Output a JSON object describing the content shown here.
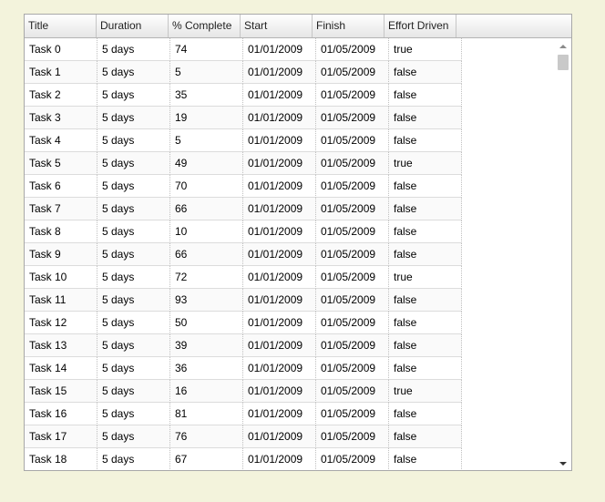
{
  "columns": [
    "Title",
    "Duration",
    "% Complete",
    "Start",
    "Finish",
    "Effort Driven"
  ],
  "rows": [
    [
      "Task 0",
      "5 days",
      "74",
      "01/01/2009",
      "01/05/2009",
      "true"
    ],
    [
      "Task 1",
      "5 days",
      "5",
      "01/01/2009",
      "01/05/2009",
      "false"
    ],
    [
      "Task 2",
      "5 days",
      "35",
      "01/01/2009",
      "01/05/2009",
      "false"
    ],
    [
      "Task 3",
      "5 days",
      "19",
      "01/01/2009",
      "01/05/2009",
      "false"
    ],
    [
      "Task 4",
      "5 days",
      "5",
      "01/01/2009",
      "01/05/2009",
      "false"
    ],
    [
      "Task 5",
      "5 days",
      "49",
      "01/01/2009",
      "01/05/2009",
      "true"
    ],
    [
      "Task 6",
      "5 days",
      "70",
      "01/01/2009",
      "01/05/2009",
      "false"
    ],
    [
      "Task 7",
      "5 days",
      "66",
      "01/01/2009",
      "01/05/2009",
      "false"
    ],
    [
      "Task 8",
      "5 days",
      "10",
      "01/01/2009",
      "01/05/2009",
      "false"
    ],
    [
      "Task 9",
      "5 days",
      "66",
      "01/01/2009",
      "01/05/2009",
      "false"
    ],
    [
      "Task 10",
      "5 days",
      "72",
      "01/01/2009",
      "01/05/2009",
      "true"
    ],
    [
      "Task 11",
      "5 days",
      "93",
      "01/01/2009",
      "01/05/2009",
      "false"
    ],
    [
      "Task 12",
      "5 days",
      "50",
      "01/01/2009",
      "01/05/2009",
      "false"
    ],
    [
      "Task 13",
      "5 days",
      "39",
      "01/01/2009",
      "01/05/2009",
      "false"
    ],
    [
      "Task 14",
      "5 days",
      "36",
      "01/01/2009",
      "01/05/2009",
      "false"
    ],
    [
      "Task 15",
      "5 days",
      "16",
      "01/01/2009",
      "01/05/2009",
      "true"
    ],
    [
      "Task 16",
      "5 days",
      "81",
      "01/01/2009",
      "01/05/2009",
      "false"
    ],
    [
      "Task 17",
      "5 days",
      "76",
      "01/01/2009",
      "01/05/2009",
      "false"
    ],
    [
      "Task 18",
      "5 days",
      "67",
      "01/01/2009",
      "01/05/2009",
      "false"
    ]
  ],
  "scrollbar": {
    "up_icon": "arrow-up-icon",
    "down_icon": "arrow-down-icon"
  },
  "colors": {
    "page_background": "#f3f3dc",
    "grid_border": "#a8a8a8",
    "scroll_thumb": "#c9c9c9"
  }
}
